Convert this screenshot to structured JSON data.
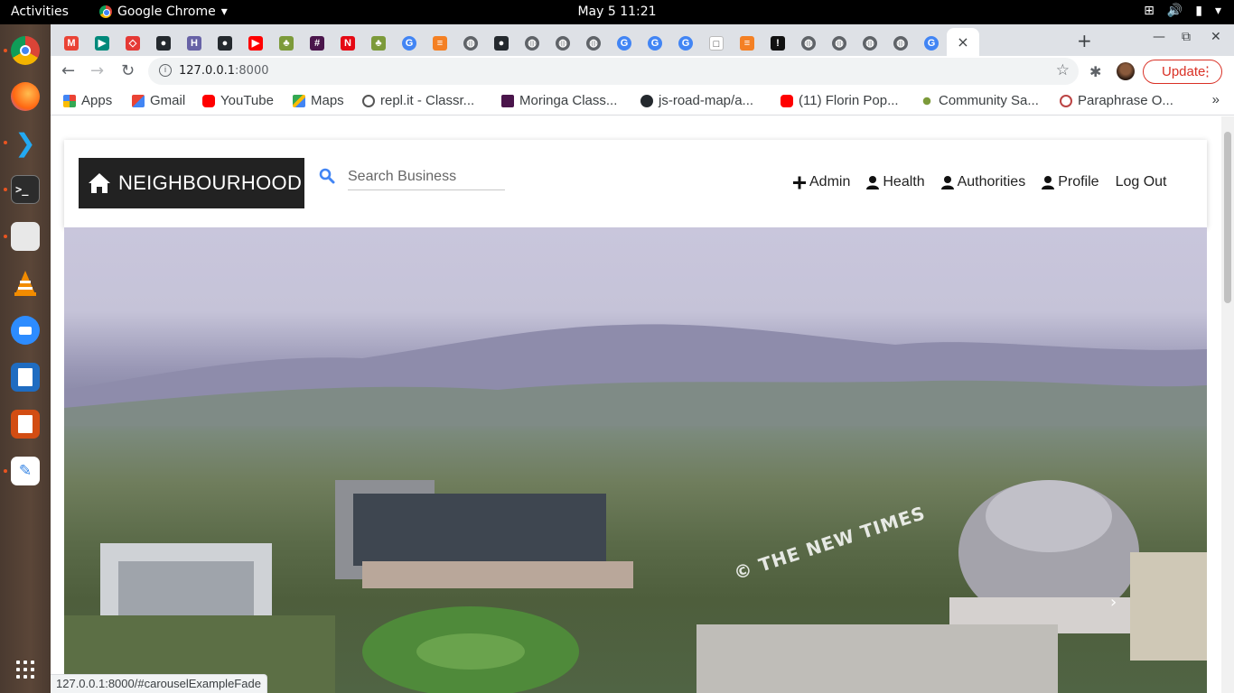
{
  "topbar": {
    "activities": "Activities",
    "app_name": "Google Chrome",
    "app_menu_arrow": "▾",
    "clock": "May 5  11:21",
    "sys_icons": [
      "network-icon",
      "volume-icon",
      "battery-icon",
      "power-menu-icon"
    ]
  },
  "dock": {
    "apps": [
      "chrome",
      "firefox",
      "vscode",
      "terminal",
      "files",
      "vlc",
      "zoom",
      "libreoffice-writer",
      "libreoffice-impress",
      "text-editor"
    ]
  },
  "chrome": {
    "active_tab_close": "×",
    "new_tab": "+",
    "tab_favicons": [
      "gmail",
      "meet",
      "codepen",
      "github",
      "heroku",
      "github",
      "youtube",
      "community",
      "slack",
      "netflix",
      "community",
      "google",
      "stackoverflow",
      "globe",
      "github",
      "globe",
      "globe",
      "globe",
      "google",
      "google",
      "google",
      "notion",
      "stackoverflow",
      "medium",
      "globe",
      "globe",
      "globe",
      "globe",
      "google"
    ],
    "window_controls": {
      "minimize": "—",
      "maximize": "⧉",
      "close": "✕"
    },
    "url_host": "127.0.0.1",
    "url_rest": ":8000",
    "update_label": "Update",
    "update_more": "⋮"
  },
  "bookmarks": [
    {
      "label": "Apps",
      "icon": "apps-grid-icon"
    },
    {
      "label": "Gmail",
      "icon": "gmail-icon"
    },
    {
      "label": "YouTube",
      "icon": "youtube-icon"
    },
    {
      "label": "Maps",
      "icon": "maps-icon"
    },
    {
      "label": "repl.it - Classr...",
      "icon": "replit-icon"
    },
    {
      "label": "Moringa Class...",
      "icon": "slack-icon"
    },
    {
      "label": "js-road-map/a...",
      "icon": "github-icon"
    },
    {
      "label": "(11) Florin Pop...",
      "icon": "youtube-icon"
    },
    {
      "label": "Community Sa...",
      "icon": "community-icon"
    },
    {
      "label": "Paraphrase O...",
      "icon": "paraphrase-icon"
    }
  ],
  "bookmarks_more": "»",
  "site": {
    "brand": "NEIGHBOURHOOD",
    "search_placeholder": "Search Business",
    "nav": {
      "admin": "Admin",
      "health": "Health",
      "authorities": "Authorities",
      "profile": "Profile",
      "logout": "Log Out"
    },
    "hero_watermark": "© THE NEW TIMES",
    "carousel_next": "›"
  },
  "status_bar_url": "127.0.0.1:8000/#carouselExampleFade",
  "colors": {
    "brand_bg": "#222222",
    "search_icon": "#4285f4",
    "update_red": "#d93025",
    "ubuntu_orange": "#e95420"
  }
}
